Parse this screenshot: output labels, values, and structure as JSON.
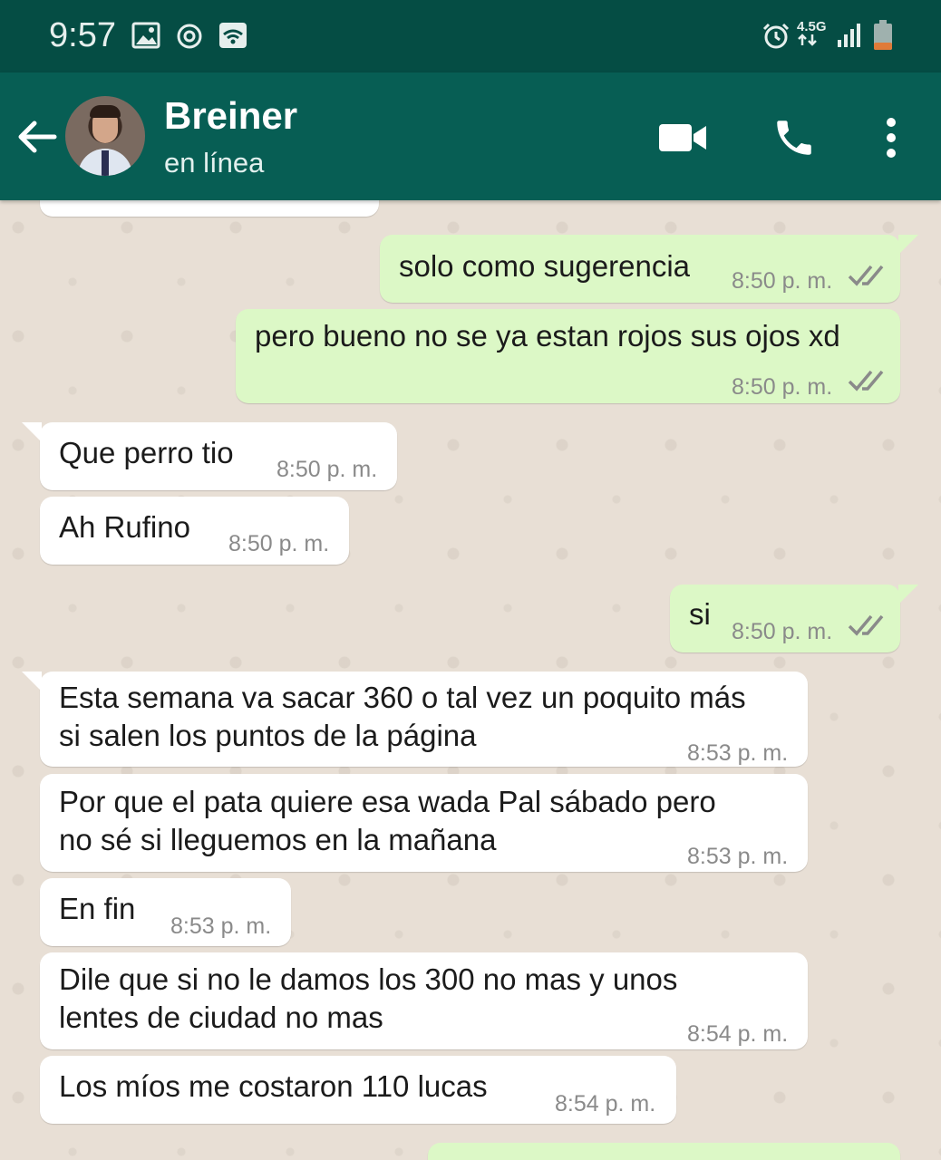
{
  "status_bar": {
    "time": "9:57",
    "network": "4.5G",
    "icons": [
      "gallery-icon",
      "sync-icon",
      "cast-icon",
      "alarm-icon",
      "data-arrows-icon",
      "signal-icon",
      "battery-icon"
    ]
  },
  "header": {
    "contact_name": "Breiner",
    "contact_status": "en línea",
    "icons": [
      "back-arrow-icon",
      "avatar",
      "video-call-icon",
      "phone-icon",
      "more-vert-icon"
    ]
  },
  "colors": {
    "status_bar": "#054d44",
    "app_bar": "#075e54",
    "chat_background": "#e8dfd5",
    "outgoing_bubble": "#dcf8c6",
    "incoming_bubble": "#ffffff",
    "read_ticks": "#8a8a8a"
  },
  "messages": [
    {
      "direction": "out",
      "lines": [
        "solo como sugerencia"
      ],
      "time": "8:50 p. m.",
      "status": "double-check-icon"
    },
    {
      "direction": "out",
      "lines": [
        "pero bueno no se ya estan rojos sus ojos xd"
      ],
      "time": "8:50 p. m.",
      "status": "double-check-icon"
    },
    {
      "direction": "in",
      "lines": [
        "Que perro tio"
      ],
      "time": "8:50 p. m."
    },
    {
      "direction": "in",
      "lines": [
        "Ah Rufino"
      ],
      "time": "8:50 p. m."
    },
    {
      "direction": "out",
      "lines": [
        "si"
      ],
      "time": "8:50 p. m.",
      "status": "double-check-icon"
    },
    {
      "direction": "in",
      "lines": [
        "Esta semana va sacar 360 o tal vez un poquito más",
        "si salen los puntos de la página"
      ],
      "time": "8:53 p. m."
    },
    {
      "direction": "in",
      "lines": [
        "Por que el pata quiere esa wada Pal sábado pero",
        "no sé si lleguemos en la mañana"
      ],
      "time": "8:53 p. m."
    },
    {
      "direction": "in",
      "lines": [
        "En fin"
      ],
      "time": "8:53 p. m."
    },
    {
      "direction": "in",
      "lines": [
        "Dile que si no le damos los 300 no mas y unos",
        "lentes de ciudad no mas"
      ],
      "time": "8:54 p. m."
    },
    {
      "direction": "in",
      "lines": [
        "Los míos me costaron 110 lucas"
      ],
      "time": "8:54 p. m."
    }
  ]
}
